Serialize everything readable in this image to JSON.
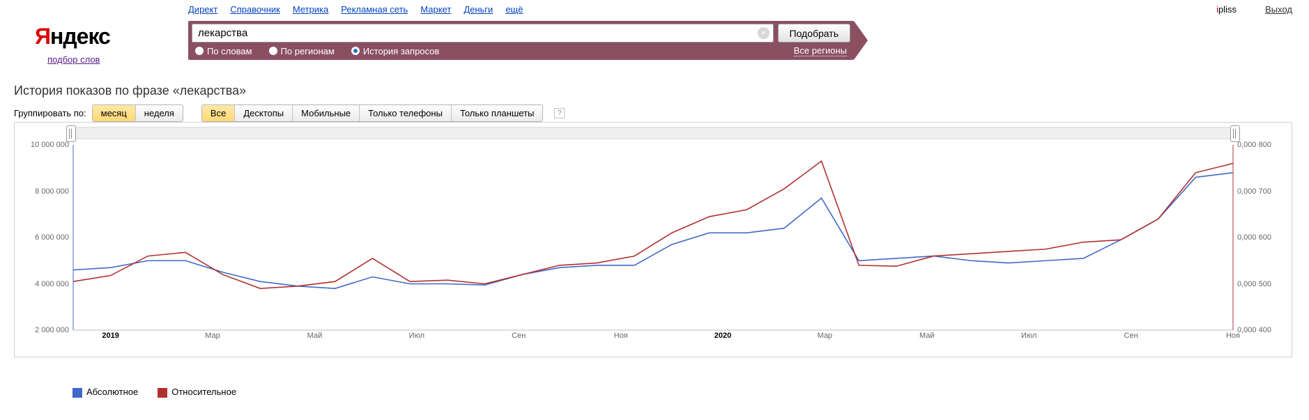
{
  "nav": {
    "items": [
      "Директ",
      "Справочник",
      "Метрика",
      "Рекламная сеть",
      "Маркет",
      "Деньги",
      "ещё"
    ]
  },
  "user": {
    "name": "ipliss"
  },
  "logout": "Выход",
  "logo": {
    "red": "Я",
    "rest": "ндекс"
  },
  "subtitle": "подбор слов",
  "search": {
    "value": "лекарства",
    "button": "Подобрать",
    "clear": "×"
  },
  "radios": {
    "items": [
      "По словам",
      "По регионам",
      "История запросов"
    ],
    "selected": 2,
    "all": "Все регионы"
  },
  "title": "История показов по фразе «лекарства»",
  "groupby": {
    "label": "Группировать по:",
    "period": [
      "месяц",
      "неделя"
    ],
    "period_sel": 0,
    "device": [
      "Все",
      "Десктопы",
      "Мобильные",
      "Только телефоны",
      "Только планшеты"
    ],
    "device_sel": 0
  },
  "legend": {
    "abs": "Абсолютное",
    "rel": "Относительное"
  },
  "chart_data": {
    "type": "line",
    "x_labels": [
      "2019",
      "Мар",
      "Май",
      "Июл",
      "Сен",
      "Ноя",
      "2020",
      "Мар",
      "Май",
      "Июл",
      "Сен",
      "Ноя"
    ],
    "x_bold": [
      0,
      6
    ],
    "y_left": {
      "ticks": [
        2000000,
        4000000,
        6000000,
        8000000,
        10000000
      ],
      "labels": [
        "2 000 000",
        "4 000 000",
        "6 000 000",
        "8 000 000",
        "10 000 000"
      ]
    },
    "y_right": {
      "ticks": [
        0.0004,
        0.0005,
        0.0006,
        0.0007,
        0.0008
      ],
      "labels": [
        "0,000 400",
        "0,000 500",
        "0,000 600",
        "0,000 700",
        "0,000 800"
      ]
    },
    "series": [
      {
        "name": "Абсолютное",
        "color": "#4169c7",
        "axis": "left",
        "values": [
          4600000,
          4700000,
          5000000,
          5000000,
          4500000,
          4100000,
          3900000,
          3800000,
          4300000,
          4000000,
          4000000,
          3950000,
          4400000,
          4700000,
          4800000,
          4800000,
          5700000,
          6200000,
          6200000,
          6400000,
          7700000,
          5000000,
          5100000,
          5200000,
          5000000,
          4900000,
          5000000,
          5100000,
          5900000,
          6800000,
          8600000,
          8800000
        ]
      },
      {
        "name": "Относительное",
        "color": "#b03030",
        "axis": "right",
        "values": [
          0.000505,
          0.000518,
          0.00056,
          0.000568,
          0.00052,
          0.00049,
          0.000495,
          0.000505,
          0.000555,
          0.000505,
          0.000508,
          0.0005,
          0.00052,
          0.00054,
          0.000545,
          0.00056,
          0.00061,
          0.000645,
          0.00066,
          0.000705,
          0.000765,
          0.00054,
          0.000538,
          0.00056,
          0.000565,
          0.00057,
          0.000575,
          0.00059,
          0.000595,
          0.00064,
          0.00074,
          0.00076
        ]
      }
    ]
  }
}
